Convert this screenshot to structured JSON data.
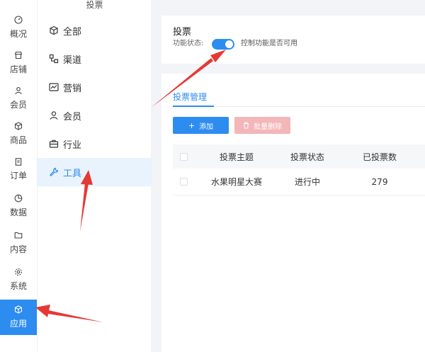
{
  "rail": {
    "items": [
      {
        "label": "概况",
        "icon": "dashboard-icon"
      },
      {
        "label": "店铺",
        "icon": "store-icon"
      },
      {
        "label": "会员",
        "icon": "user-icon"
      },
      {
        "label": "商品",
        "icon": "box-icon"
      },
      {
        "label": "订单",
        "icon": "clipboard-icon"
      },
      {
        "label": "数据",
        "icon": "pie-icon"
      },
      {
        "label": "内容",
        "icon": "folder-icon"
      },
      {
        "label": "系统",
        "icon": "gear-icon"
      },
      {
        "label": "应用",
        "icon": "cube-icon"
      }
    ],
    "active": "应用"
  },
  "submenu": {
    "title": "投票",
    "items": [
      {
        "label": "全部",
        "icon": "cube-icon"
      },
      {
        "label": "渠道",
        "icon": "channel-icon"
      },
      {
        "label": "营销",
        "icon": "trend-icon"
      },
      {
        "label": "会员",
        "icon": "user-icon"
      },
      {
        "label": "行业",
        "icon": "briefcase-icon"
      },
      {
        "label": "工具",
        "icon": "wrench-icon"
      }
    ],
    "active": "工具"
  },
  "vote_card": {
    "title": "投票",
    "status_label": "功能状态:",
    "toggle_on": true,
    "status_desc": "控制功能是否可用"
  },
  "manage": {
    "tab": "投票管理",
    "add_button": "添加",
    "batch_delete_button": "批量删除",
    "columns": [
      "投票主题",
      "投票状态",
      "已投票数"
    ],
    "rows": [
      {
        "topic": "水果明星大赛",
        "status": "进行中",
        "count": "279"
      }
    ]
  },
  "colors": {
    "accent": "#2d8cf0",
    "annotation": "#e53935",
    "danger_disabled": "#f3b6b9"
  }
}
